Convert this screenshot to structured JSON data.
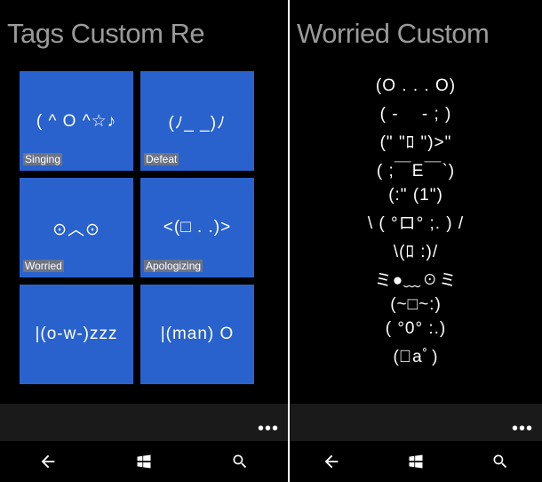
{
  "left": {
    "header": "Tags Custom Re",
    "tiles": [
      {
        "face": "( ^ O ^☆♪",
        "label": "Singing"
      },
      {
        "face": "(ﾉ_ _)ﾉ",
        "label": "Defeat"
      },
      {
        "face": "⊙︿⊙",
        "label": "Worried"
      },
      {
        "face": "<(□ . .)>",
        "label": "Apologizing"
      },
      {
        "face": "|(o-w-)zzz",
        "label": ""
      },
      {
        "face": "|(man) O",
        "label": ""
      }
    ],
    "appbar_more": "•••"
  },
  "right": {
    "header": "Worried Custom",
    "items": [
      "(O . . . O)",
      "( - 　- ; )",
      "(\" \"ﾛ \")>\"",
      "( ;￣E￣`)",
      "(:\" (1\")",
      "\\ ( °ロ° ;. ) /",
      "\\(ﾛ :)/",
      "ミ●﹏☉ミ",
      "(~□~:)",
      "( °0° :.)",
      "(ﾟaﾟ)"
    ],
    "appbar_more": "•••"
  },
  "nav": {
    "back": "back",
    "start": "start",
    "search": "search"
  }
}
